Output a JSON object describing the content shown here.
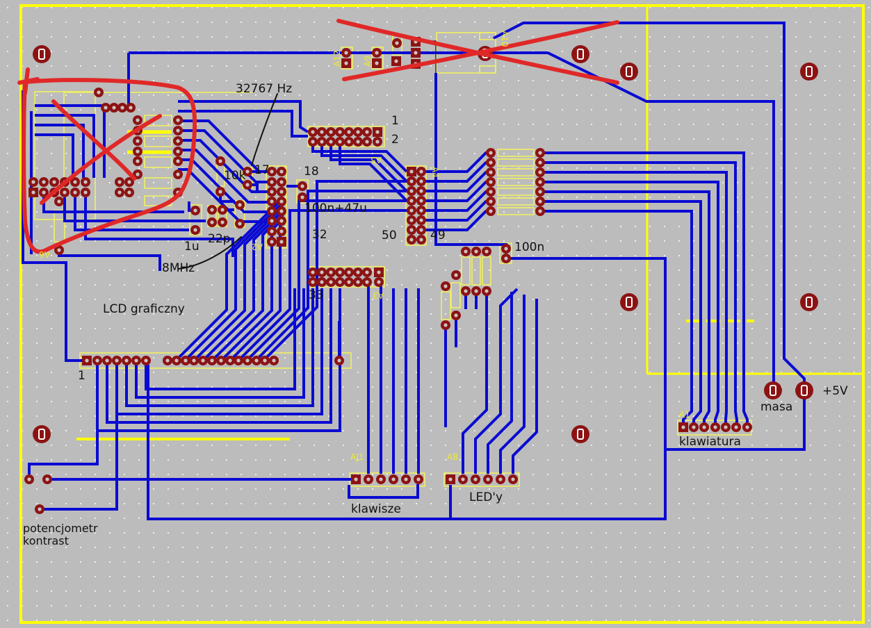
{
  "app": {
    "view": "pcb-board-layout",
    "description": "PCB layout with hand-drawn red correction marks"
  },
  "colors": {
    "background": "#bcbcbc",
    "grid_dot": "#efefef",
    "trace_blue": "#0a0ad2",
    "pad_dark_red": "#8d1313",
    "board_outline_yellow": "#ffff00",
    "silk_outline_pale_yellow": "#f3f35c",
    "marker_red": "#e02828",
    "annotation_black": "#111111"
  },
  "annotations": {
    "crystal_32k": "32767 Hz",
    "crystal_8m": "8MHz",
    "resistor_10k": "10k",
    "cap_100n_47u": "100n+47u",
    "cap_22p": "22p",
    "cap_1u": "1u",
    "cap_100n": "100n",
    "pin_1": "1",
    "pin_2": "2",
    "pin_17": "17",
    "pin_18": "18",
    "pin_32": "32",
    "pin_33": "33",
    "pin_49": "49",
    "pin_50": "50",
    "lcd": "LCD graficzny",
    "lcd_pin1": "1",
    "keys": "klawisze",
    "leds": "LED'y",
    "keyboard": "klawiatura",
    "gnd": "masa",
    "vcc": "+5V",
    "pot_line1": "potencjometr",
    "pot_line2": "kontrast"
  },
  "reference_designators": {
    "a12": "A12",
    "a9": "A9",
    "a10": "A10",
    "a5": "A5",
    "a4": "A4",
    "a2": "A2",
    "a3": "A3",
    "a6": "A6",
    "aj1": "AJ1",
    "a8": "A8",
    "a1": "A1"
  }
}
